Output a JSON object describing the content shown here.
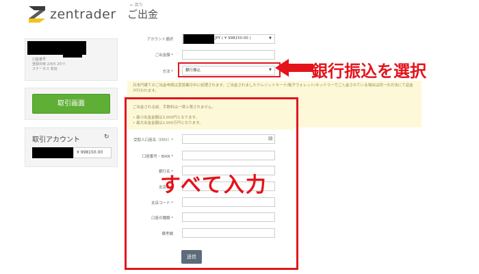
{
  "logo": {
    "text": "zentrader"
  },
  "header": {
    "breadcrumb": "← 戻り",
    "title": "ご出金"
  },
  "sidebar": {
    "profile": {
      "line1": "口座番号",
      "line2": "登録日時 2/4/5 20!!!",
      "line3": "ステータス 有効"
    },
    "trade_button_label": "取引画面",
    "account": {
      "title": "取引アカウント",
      "balance": "¥ 998150.00"
    }
  },
  "form": {
    "account_label": "アカウント選択",
    "account_value": "JPY ( ¥ 998150.00 )",
    "amount_label": "ご出金額 *",
    "method_label": "方法 *",
    "method_value": "銀行振込",
    "notice_text": "日本円建てのご出金申請は翌営業日中に処理されます。ご出金されましたクレジットカード/電子ウォレット/ネッテラーでご入金されている場合は同一の方法にて返金が行われます。",
    "notice_2_line1": "ご出金される前、手数料は一律上限されません。",
    "notice_2_line2": "• 最小出金金額は3,000円となります。",
    "notice_2_line3": "• 最大出金金額は1,000万円となります。",
    "receiver_label": "受取人口座名（ｶﾀｶﾅ）*",
    "iban_label": "口座番号・IBAN *",
    "bank_label": "銀行名 *",
    "branch_label": "支店名 *",
    "postal_label": "支店コード *",
    "type_label": "口座の種類 *",
    "note_label": "備考欄",
    "send_label": "送信"
  },
  "annotations": {
    "select_bank": "銀行振込を選択",
    "input_all": "すべて入力"
  },
  "colors": {
    "accent_red": "#e3141b",
    "trade_green": "#5fae35",
    "notice_bg": "#fdf9d8",
    "send_button": "#5d6b7a"
  },
  "icons": {
    "refresh": "refresh-icon",
    "caret": "chevron-down-icon",
    "receiver": "id-card-icon"
  }
}
